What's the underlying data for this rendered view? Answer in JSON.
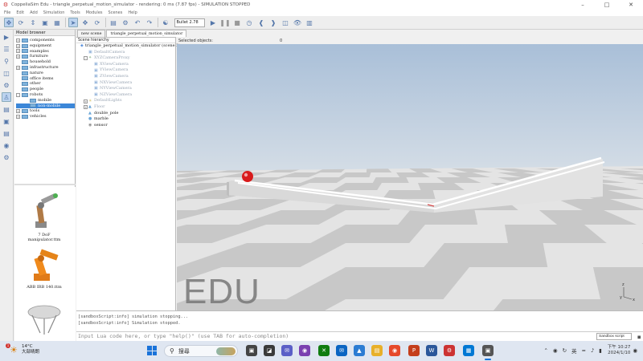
{
  "window": {
    "title": "CoppeliaSim Edu - triangle_perpetual_motion_simulator - rendering: 0 ms (7.87 fps) - SIMULATION STOPPED",
    "controls": [
      "–",
      "□",
      "✕"
    ]
  },
  "menu": [
    "File",
    "Edit",
    "Add",
    "Simulation",
    "Tools",
    "Modules",
    "Scenes",
    "Help"
  ],
  "toolbar": {
    "engine": "Bullet 2.78"
  },
  "model_browser": {
    "title": "Model browser",
    "items": [
      {
        "label": "components",
        "exp": "+"
      },
      {
        "label": "equipment",
        "exp": "+"
      },
      {
        "label": "examples",
        "exp": "+"
      },
      {
        "label": "furniture",
        "exp": "+"
      },
      {
        "label": "household",
        "exp": ""
      },
      {
        "label": "infrastructure",
        "exp": "+"
      },
      {
        "label": "nature",
        "exp": ""
      },
      {
        "label": "office items",
        "exp": ""
      },
      {
        "label": "other",
        "exp": ""
      },
      {
        "label": "people",
        "exp": ""
      },
      {
        "label": "robots",
        "exp": "-"
      },
      {
        "label": "mobile",
        "exp": "",
        "indent": 1
      },
      {
        "label": "non-mobile",
        "exp": "",
        "indent": 1,
        "selected": true
      },
      {
        "label": "tools",
        "exp": "+"
      },
      {
        "label": "vehicles",
        "exp": "+"
      }
    ],
    "thumbnails": [
      {
        "label": "7 DoF manipulator.ttm"
      },
      {
        "label": "ABB IRB 140.ttm"
      }
    ]
  },
  "scene": {
    "tabs": [
      "new scene",
      "triangle_perpetual_motion_simulator"
    ],
    "hierarchy_title": "Scene hierarchy",
    "items": [
      {
        "label": "triangle_perpetual_motion_simulator (scene 2)",
        "level": 0,
        "icon": "scene",
        "dim": false,
        "exp": ""
      },
      {
        "label": "DefaultCamera",
        "level": 1,
        "icon": "camera",
        "dim": true,
        "exp": ""
      },
      {
        "label": "XYZCameraProxy",
        "level": 1,
        "icon": "dummy",
        "dim": true,
        "exp": "-"
      },
      {
        "label": "XViewCamera",
        "level": 2,
        "icon": "camera",
        "dim": true,
        "exp": ""
      },
      {
        "label": "YViewCamera",
        "level": 2,
        "icon": "camera",
        "dim": true,
        "exp": ""
      },
      {
        "label": "ZViewCamera",
        "level": 2,
        "icon": "camera",
        "dim": true,
        "exp": ""
      },
      {
        "label": "NXViewCamera",
        "level": 2,
        "icon": "camera",
        "dim": true,
        "exp": ""
      },
      {
        "label": "NYViewCamera",
        "level": 2,
        "icon": "camera",
        "dim": true,
        "exp": ""
      },
      {
        "label": "NZViewCamera",
        "level": 2,
        "icon": "camera",
        "dim": true,
        "exp": ""
      },
      {
        "label": "DefaultLights",
        "level": 1,
        "icon": "light",
        "dim": true,
        "exp": "+"
      },
      {
        "label": "Floor",
        "level": 1,
        "icon": "shape",
        "dim": true,
        "exp": "+"
      },
      {
        "label": "double_pole",
        "level": 1,
        "icon": "shape",
        "dim": false,
        "exp": ""
      },
      {
        "label": "marble",
        "level": 1,
        "icon": "sphere",
        "dim": false,
        "exp": ""
      },
      {
        "label": "sensor",
        "level": 1,
        "icon": "sensor",
        "dim": false,
        "exp": ""
      }
    ]
  },
  "viewport": {
    "selected_label": "Selected objects:",
    "selected_count": "0",
    "watermark": "EDU",
    "colors": {
      "floor_light": "#e6e6e6",
      "floor_dark": "#c8c8c8",
      "sky": "#b7cadf",
      "marble": "#d81b1b"
    }
  },
  "console": {
    "lines": [
      "[sandboxScript:info] simulation stopping...",
      "[sandboxScript:info] Simulation stopped."
    ],
    "input_placeholder": "Input Lua code here, or type \"help()\" (use TAB for auto-completion)",
    "script_select": "Sandbox script"
  },
  "taskbar": {
    "weather_temp": "14°C",
    "weather_desc": "大部晴朗",
    "weather_badge": "1",
    "search_label": "搜尋",
    "ime": "英",
    "time": "下午 10:27",
    "date": "2024/1/10"
  }
}
